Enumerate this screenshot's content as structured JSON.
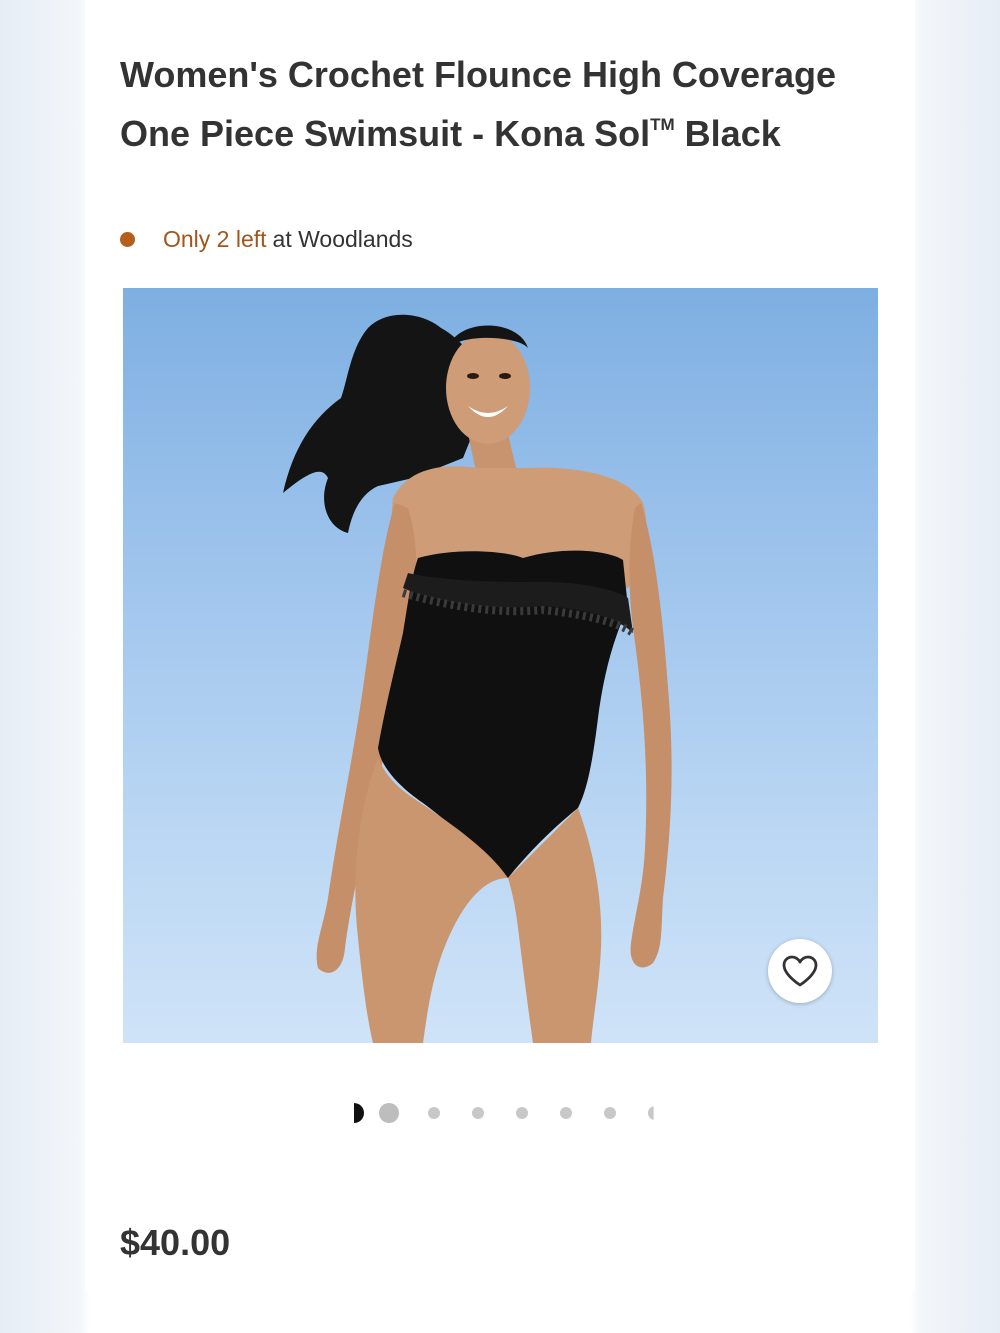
{
  "product": {
    "title": "Women's Crochet Flounce High Coverage One Piece Swimsuit - Kona Sol",
    "trademark": "TM",
    "title_suffix": " Black",
    "price": "$40.00"
  },
  "stock": {
    "count_text": "Only 2 left",
    "store_text": "at Woodlands",
    "status_color": "#b35f1d"
  },
  "gallery": {
    "image_alt": "Model wearing black strapless one piece swimsuit with crochet flounce",
    "current_index": 1,
    "total_visible_dots": 8
  },
  "icons": {
    "favorite": "heart-icon",
    "stock_status": "status-dot-icon"
  }
}
